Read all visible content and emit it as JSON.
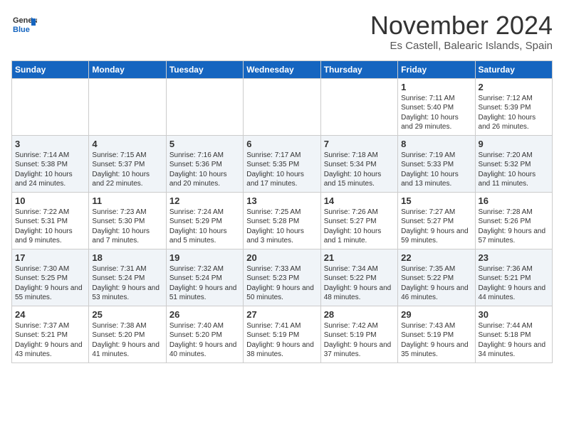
{
  "logo": {
    "line1": "General",
    "line2": "Blue"
  },
  "title": "November 2024",
  "location": "Es Castell, Balearic Islands, Spain",
  "days_of_week": [
    "Sunday",
    "Monday",
    "Tuesday",
    "Wednesday",
    "Thursday",
    "Friday",
    "Saturday"
  ],
  "weeks": [
    [
      {
        "day": "",
        "info": ""
      },
      {
        "day": "",
        "info": ""
      },
      {
        "day": "",
        "info": ""
      },
      {
        "day": "",
        "info": ""
      },
      {
        "day": "",
        "info": ""
      },
      {
        "day": "1",
        "info": "Sunrise: 7:11 AM\nSunset: 5:40 PM\nDaylight: 10 hours and 29 minutes."
      },
      {
        "day": "2",
        "info": "Sunrise: 7:12 AM\nSunset: 5:39 PM\nDaylight: 10 hours and 26 minutes."
      }
    ],
    [
      {
        "day": "3",
        "info": "Sunrise: 7:14 AM\nSunset: 5:38 PM\nDaylight: 10 hours and 24 minutes."
      },
      {
        "day": "4",
        "info": "Sunrise: 7:15 AM\nSunset: 5:37 PM\nDaylight: 10 hours and 22 minutes."
      },
      {
        "day": "5",
        "info": "Sunrise: 7:16 AM\nSunset: 5:36 PM\nDaylight: 10 hours and 20 minutes."
      },
      {
        "day": "6",
        "info": "Sunrise: 7:17 AM\nSunset: 5:35 PM\nDaylight: 10 hours and 17 minutes."
      },
      {
        "day": "7",
        "info": "Sunrise: 7:18 AM\nSunset: 5:34 PM\nDaylight: 10 hours and 15 minutes."
      },
      {
        "day": "8",
        "info": "Sunrise: 7:19 AM\nSunset: 5:33 PM\nDaylight: 10 hours and 13 minutes."
      },
      {
        "day": "9",
        "info": "Sunrise: 7:20 AM\nSunset: 5:32 PM\nDaylight: 10 hours and 11 minutes."
      }
    ],
    [
      {
        "day": "10",
        "info": "Sunrise: 7:22 AM\nSunset: 5:31 PM\nDaylight: 10 hours and 9 minutes."
      },
      {
        "day": "11",
        "info": "Sunrise: 7:23 AM\nSunset: 5:30 PM\nDaylight: 10 hours and 7 minutes."
      },
      {
        "day": "12",
        "info": "Sunrise: 7:24 AM\nSunset: 5:29 PM\nDaylight: 10 hours and 5 minutes."
      },
      {
        "day": "13",
        "info": "Sunrise: 7:25 AM\nSunset: 5:28 PM\nDaylight: 10 hours and 3 minutes."
      },
      {
        "day": "14",
        "info": "Sunrise: 7:26 AM\nSunset: 5:27 PM\nDaylight: 10 hours and 1 minute."
      },
      {
        "day": "15",
        "info": "Sunrise: 7:27 AM\nSunset: 5:27 PM\nDaylight: 9 hours and 59 minutes."
      },
      {
        "day": "16",
        "info": "Sunrise: 7:28 AM\nSunset: 5:26 PM\nDaylight: 9 hours and 57 minutes."
      }
    ],
    [
      {
        "day": "17",
        "info": "Sunrise: 7:30 AM\nSunset: 5:25 PM\nDaylight: 9 hours and 55 minutes."
      },
      {
        "day": "18",
        "info": "Sunrise: 7:31 AM\nSunset: 5:24 PM\nDaylight: 9 hours and 53 minutes."
      },
      {
        "day": "19",
        "info": "Sunrise: 7:32 AM\nSunset: 5:24 PM\nDaylight: 9 hours and 51 minutes."
      },
      {
        "day": "20",
        "info": "Sunrise: 7:33 AM\nSunset: 5:23 PM\nDaylight: 9 hours and 50 minutes."
      },
      {
        "day": "21",
        "info": "Sunrise: 7:34 AM\nSunset: 5:22 PM\nDaylight: 9 hours and 48 minutes."
      },
      {
        "day": "22",
        "info": "Sunrise: 7:35 AM\nSunset: 5:22 PM\nDaylight: 9 hours and 46 minutes."
      },
      {
        "day": "23",
        "info": "Sunrise: 7:36 AM\nSunset: 5:21 PM\nDaylight: 9 hours and 44 minutes."
      }
    ],
    [
      {
        "day": "24",
        "info": "Sunrise: 7:37 AM\nSunset: 5:21 PM\nDaylight: 9 hours and 43 minutes."
      },
      {
        "day": "25",
        "info": "Sunrise: 7:38 AM\nSunset: 5:20 PM\nDaylight: 9 hours and 41 minutes."
      },
      {
        "day": "26",
        "info": "Sunrise: 7:40 AM\nSunset: 5:20 PM\nDaylight: 9 hours and 40 minutes."
      },
      {
        "day": "27",
        "info": "Sunrise: 7:41 AM\nSunset: 5:19 PM\nDaylight: 9 hours and 38 minutes."
      },
      {
        "day": "28",
        "info": "Sunrise: 7:42 AM\nSunset: 5:19 PM\nDaylight: 9 hours and 37 minutes."
      },
      {
        "day": "29",
        "info": "Sunrise: 7:43 AM\nSunset: 5:19 PM\nDaylight: 9 hours and 35 minutes."
      },
      {
        "day": "30",
        "info": "Sunrise: 7:44 AM\nSunset: 5:18 PM\nDaylight: 9 hours and 34 minutes."
      }
    ]
  ]
}
